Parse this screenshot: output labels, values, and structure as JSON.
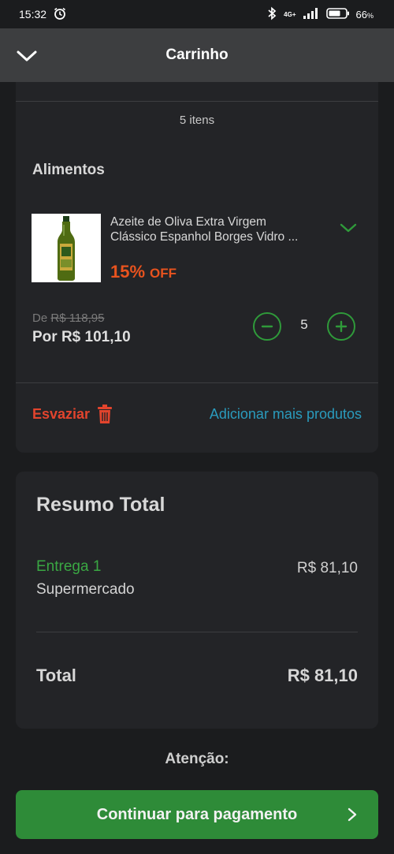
{
  "status": {
    "time": "15:32",
    "network": "4G+",
    "battery": "66",
    "battery_unit": "%",
    "icons": [
      "alarm-icon",
      "bluetooth-icon",
      "signal-icon",
      "battery-icon"
    ]
  },
  "header": {
    "title": "Carrinho",
    "back_icon": "chevron-down-icon"
  },
  "cart": {
    "items_count": "5 itens",
    "section": "Alimentos",
    "product": {
      "name_line1": "Azeite de Oliva Extra Virgem",
      "name_line2": "Clássico Espanhol Borges Vidro ...",
      "discount_pct": "15%",
      "discount_off": "OFF",
      "old_price_prefix": "De",
      "old_price": "R$ 118,95",
      "new_price": "Por R$ 101,10",
      "quantity": "5"
    },
    "empty_label": "Esvaziar",
    "add_more_label": "Adicionar mais produtos"
  },
  "summary": {
    "title": "Resumo Total",
    "delivery_label": "Entrega 1",
    "delivery_store": "Supermercado",
    "delivery_price": "R$ 81,10",
    "total_label": "Total",
    "total_value": "R$ 81,10"
  },
  "attention": "Atenção:",
  "pay_button": "Continuar para pagamento",
  "colors": {
    "background": "#1b1c1e",
    "card": "#232427",
    "header": "#3d3e40",
    "accent_green": "#2e8b38",
    "discount_orange": "#e8531e",
    "danger_red": "#e2442d",
    "link_blue": "#2a9bbd"
  }
}
